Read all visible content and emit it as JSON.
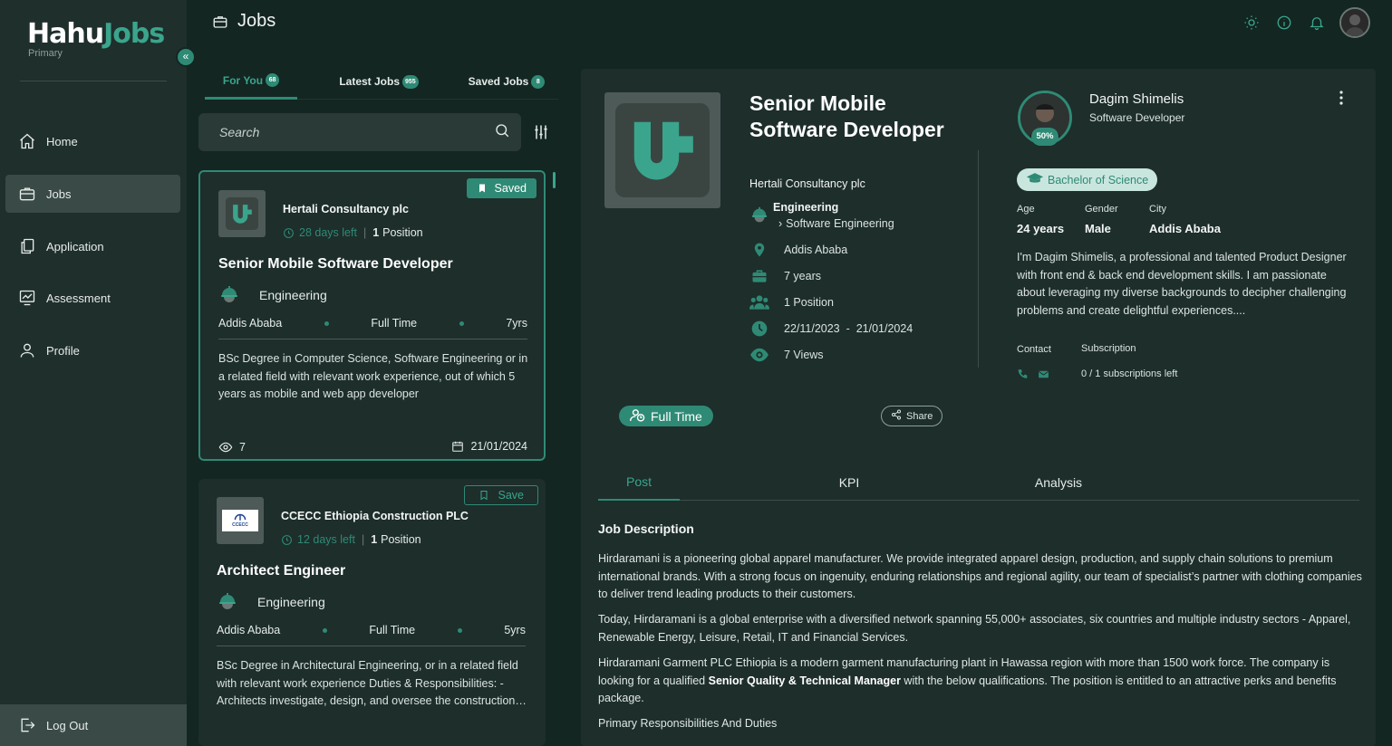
{
  "brand": {
    "logo_part1": "Hahu",
    "logo_part2": "Jobs",
    "subtitle": "Primary"
  },
  "sidebar": {
    "items": [
      {
        "label": "Home",
        "icon": "home-icon"
      },
      {
        "label": "Jobs",
        "icon": "briefcase-icon",
        "active": true
      },
      {
        "label": "Application",
        "icon": "documents-icon"
      },
      {
        "label": "Assessment",
        "icon": "chart-icon"
      },
      {
        "label": "Profile",
        "icon": "user-icon"
      }
    ],
    "logout_label": "Log Out"
  },
  "header": {
    "title": "Jobs"
  },
  "tabs": [
    {
      "label": "For You",
      "count": "68",
      "active": true
    },
    {
      "label": "Latest Jobs",
      "count": "955"
    },
    {
      "label": "Saved Jobs",
      "count": "8"
    }
  ],
  "search": {
    "placeholder": "Search"
  },
  "cards": [
    {
      "company": "Hertali Consultancy plc",
      "days_left": "28 days left",
      "positions_num": "1",
      "positions_label": "Position",
      "title": "Senior Mobile Software Developer",
      "category": "Engineering",
      "location": "Addis Ababa",
      "type": "Full Time",
      "experience": "7yrs",
      "description": "BSc Degree in Computer Science, Software Engineering or in a related field with relevant work experience, out of which 5 years as mobile and web app developer",
      "views": "7",
      "date": "21/01/2024",
      "save_label": "Saved"
    },
    {
      "company": "CCECC Ethiopia Construction PLC",
      "days_left": "12 days left",
      "positions_num": "1",
      "positions_label": "Position",
      "title": "Architect Engineer",
      "category": "Engineering",
      "location": "Addis Ababa",
      "type": "Full Time",
      "experience": "5yrs",
      "description": "BSc Degree in Architectural Engineering, or in a related field with relevant work experience Duties & Responsibilities: - Architects investigate, design, and oversee the construction…",
      "save_label": "Save",
      "logo_text": "CCECC"
    }
  ],
  "detail": {
    "title": "Senior Mobile Software Developer",
    "company": "Hertali Consultancy plc",
    "category": "Engineering",
    "subcategory": "Software Engineering",
    "location": "Addis Ababa",
    "experience": "7 years",
    "positions": "1 Position",
    "date_range": "22/11/2023  -  21/01/2024",
    "views": "7 Views",
    "employment_type": "Full Time",
    "share_label": "Share",
    "tabs": [
      "Post",
      "KPI",
      "Analysis"
    ],
    "job_description_heading": "Job Description",
    "paragraphs": [
      "Hirdaramani is a pioneering global apparel manufacturer. We provide integrated apparel design, production, and supply chain solutions to premium international brands. With a strong focus on ingenuity, enduring relationships and regional agility, our team of specialist’s partner with clothing companies to deliver trend leading products to their customers.",
      "Today, Hirdaramani is a global enterprise with a diversified network spanning 55,000+ associates, six countries and multiple industry sectors - Apparel, Renewable Energy, Leisure, Retail, IT and Financial Services."
    ],
    "p3_before": "Hirdaramani Garment PLC Ethiopia is a modern garment manufacturing plant in Hawassa region with more than 1500 work force. The company is looking for a qualified ",
    "p3_bold": "Senior Quality & Technical Manager",
    "p3_after": " with the below qualifications. The position is entitled to an attractive perks and benefits package.",
    "p4": "Primary Responsibilities And Duties"
  },
  "profile": {
    "name": "Dagim Shimelis",
    "role": "Software Developer",
    "completion": "50%",
    "degree": "Bachelor of Science",
    "age_label": "Age",
    "age": "24 years",
    "gender_label": "Gender",
    "gender": "Male",
    "city_label": "City",
    "city": "Addis Ababa",
    "bio": "I'm Dagim Shimelis, a professional and talented Product Designer with front end & back end development skills. I am passionate about leveraging my diverse backgrounds to decipher challenging problems and create delightful experiences....",
    "contact_label": "Contact",
    "subscription_label": "Subscription",
    "subscription_value": "0 / 1 subscriptions left"
  },
  "colors": {
    "accent": "#2f8a75",
    "bg": "#132622",
    "sidebar": "#1f2f2c",
    "card": "#1d2e2b"
  }
}
